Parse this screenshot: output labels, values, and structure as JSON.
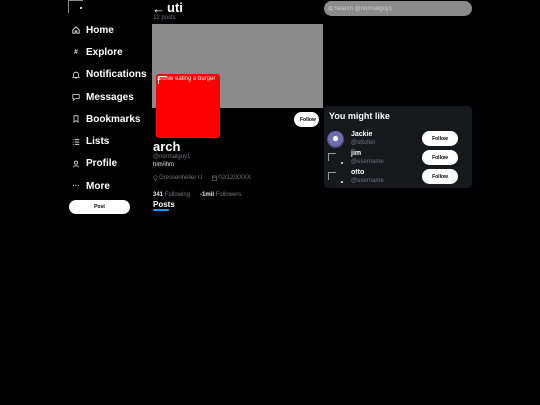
{
  "nav": {
    "items": [
      {
        "label": "Home",
        "icon": "home-icon"
      },
      {
        "label": "Explore",
        "icon": "hashtag-icon"
      },
      {
        "label": "Notifications",
        "icon": "bell-icon"
      },
      {
        "label": "Messages",
        "icon": "message-icon"
      },
      {
        "label": "Bookmarks",
        "icon": "bookmark-icon"
      },
      {
        "label": "Lists",
        "icon": "list-icon"
      },
      {
        "label": "Profile",
        "icon": "user-icon"
      },
      {
        "label": "More",
        "icon": "more-icon"
      }
    ],
    "post_label": "Post"
  },
  "header": {
    "back_arrow": "←",
    "title": "uti",
    "posts_count": "12 posts"
  },
  "profile": {
    "avatar_alt": "archie eating a burger",
    "avatar_color": "#ff0000",
    "banner_color": "#8a8a8a",
    "follow_label": "Follow",
    "display_name": "arch",
    "handle": "@normalguy1",
    "bio": "him/ihm",
    "location": "Gressenheller U",
    "joined": "02/12/XXXX",
    "following_count": "341",
    "following_label": "Following",
    "followers_count": "-1mil",
    "followers_label": "Followers",
    "tab_posts": "Posts",
    "accent_color": "#1d9bf0"
  },
  "search": {
    "placeholder": "Search @normalguy1"
  },
  "you_might_like": {
    "title": "You might like",
    "users": [
      {
        "name": "Jackie",
        "handle": "@ottofen",
        "follow_label": "Follow"
      },
      {
        "name": "jim",
        "handle": "@username",
        "follow_label": "Follow"
      },
      {
        "name": "otto",
        "handle": "@username",
        "follow_label": "Follow"
      }
    ]
  }
}
